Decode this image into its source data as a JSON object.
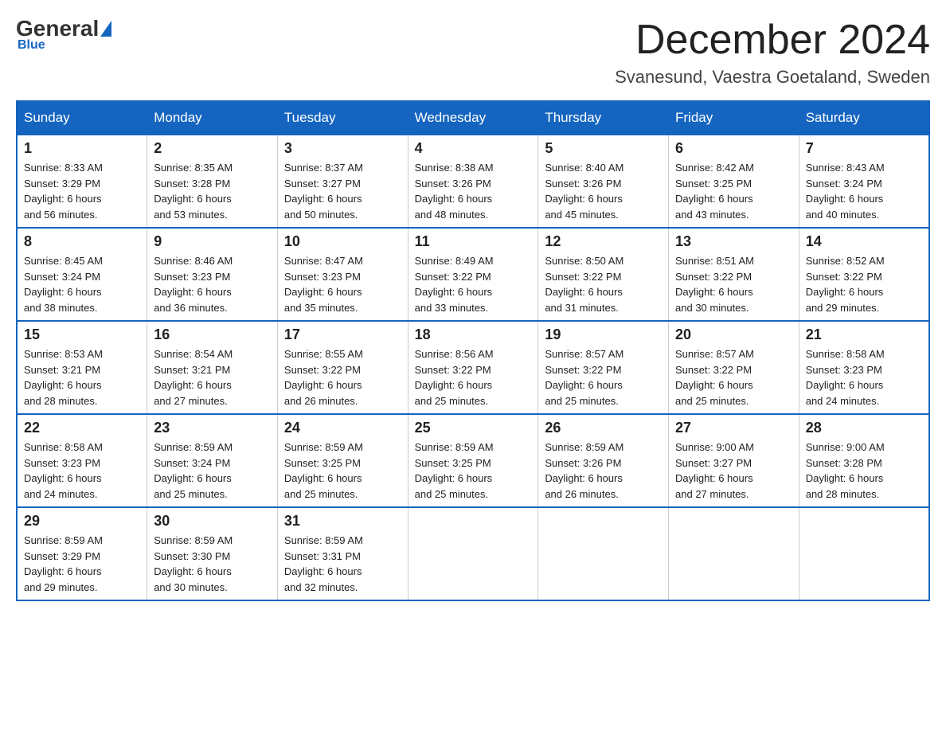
{
  "logo": {
    "general": "General",
    "blue_text": "Blue",
    "underline": "Blue"
  },
  "header": {
    "month": "December 2024",
    "location": "Svanesund, Vaestra Goetaland, Sweden"
  },
  "weekdays": [
    "Sunday",
    "Monday",
    "Tuesday",
    "Wednesday",
    "Thursday",
    "Friday",
    "Saturday"
  ],
  "weeks": [
    [
      {
        "day": "1",
        "sunrise": "8:33 AM",
        "sunset": "3:29 PM",
        "daylight": "6 hours and 56 minutes."
      },
      {
        "day": "2",
        "sunrise": "8:35 AM",
        "sunset": "3:28 PM",
        "daylight": "6 hours and 53 minutes."
      },
      {
        "day": "3",
        "sunrise": "8:37 AM",
        "sunset": "3:27 PM",
        "daylight": "6 hours and 50 minutes."
      },
      {
        "day": "4",
        "sunrise": "8:38 AM",
        "sunset": "3:26 PM",
        "daylight": "6 hours and 48 minutes."
      },
      {
        "day": "5",
        "sunrise": "8:40 AM",
        "sunset": "3:26 PM",
        "daylight": "6 hours and 45 minutes."
      },
      {
        "day": "6",
        "sunrise": "8:42 AM",
        "sunset": "3:25 PM",
        "daylight": "6 hours and 43 minutes."
      },
      {
        "day": "7",
        "sunrise": "8:43 AM",
        "sunset": "3:24 PM",
        "daylight": "6 hours and 40 minutes."
      }
    ],
    [
      {
        "day": "8",
        "sunrise": "8:45 AM",
        "sunset": "3:24 PM",
        "daylight": "6 hours and 38 minutes."
      },
      {
        "day": "9",
        "sunrise": "8:46 AM",
        "sunset": "3:23 PM",
        "daylight": "6 hours and 36 minutes."
      },
      {
        "day": "10",
        "sunrise": "8:47 AM",
        "sunset": "3:23 PM",
        "daylight": "6 hours and 35 minutes."
      },
      {
        "day": "11",
        "sunrise": "8:49 AM",
        "sunset": "3:22 PM",
        "daylight": "6 hours and 33 minutes."
      },
      {
        "day": "12",
        "sunrise": "8:50 AM",
        "sunset": "3:22 PM",
        "daylight": "6 hours and 31 minutes."
      },
      {
        "day": "13",
        "sunrise": "8:51 AM",
        "sunset": "3:22 PM",
        "daylight": "6 hours and 30 minutes."
      },
      {
        "day": "14",
        "sunrise": "8:52 AM",
        "sunset": "3:22 PM",
        "daylight": "6 hours and 29 minutes."
      }
    ],
    [
      {
        "day": "15",
        "sunrise": "8:53 AM",
        "sunset": "3:21 PM",
        "daylight": "6 hours and 28 minutes."
      },
      {
        "day": "16",
        "sunrise": "8:54 AM",
        "sunset": "3:21 PM",
        "daylight": "6 hours and 27 minutes."
      },
      {
        "day": "17",
        "sunrise": "8:55 AM",
        "sunset": "3:22 PM",
        "daylight": "6 hours and 26 minutes."
      },
      {
        "day": "18",
        "sunrise": "8:56 AM",
        "sunset": "3:22 PM",
        "daylight": "6 hours and 25 minutes."
      },
      {
        "day": "19",
        "sunrise": "8:57 AM",
        "sunset": "3:22 PM",
        "daylight": "6 hours and 25 minutes."
      },
      {
        "day": "20",
        "sunrise": "8:57 AM",
        "sunset": "3:22 PM",
        "daylight": "6 hours and 25 minutes."
      },
      {
        "day": "21",
        "sunrise": "8:58 AM",
        "sunset": "3:23 PM",
        "daylight": "6 hours and 24 minutes."
      }
    ],
    [
      {
        "day": "22",
        "sunrise": "8:58 AM",
        "sunset": "3:23 PM",
        "daylight": "6 hours and 24 minutes."
      },
      {
        "day": "23",
        "sunrise": "8:59 AM",
        "sunset": "3:24 PM",
        "daylight": "6 hours and 25 minutes."
      },
      {
        "day": "24",
        "sunrise": "8:59 AM",
        "sunset": "3:25 PM",
        "daylight": "6 hours and 25 minutes."
      },
      {
        "day": "25",
        "sunrise": "8:59 AM",
        "sunset": "3:25 PM",
        "daylight": "6 hours and 25 minutes."
      },
      {
        "day": "26",
        "sunrise": "8:59 AM",
        "sunset": "3:26 PM",
        "daylight": "6 hours and 26 minutes."
      },
      {
        "day": "27",
        "sunrise": "9:00 AM",
        "sunset": "3:27 PM",
        "daylight": "6 hours and 27 minutes."
      },
      {
        "day": "28",
        "sunrise": "9:00 AM",
        "sunset": "3:28 PM",
        "daylight": "6 hours and 28 minutes."
      }
    ],
    [
      {
        "day": "29",
        "sunrise": "8:59 AM",
        "sunset": "3:29 PM",
        "daylight": "6 hours and 29 minutes."
      },
      {
        "day": "30",
        "sunrise": "8:59 AM",
        "sunset": "3:30 PM",
        "daylight": "6 hours and 30 minutes."
      },
      {
        "day": "31",
        "sunrise": "8:59 AM",
        "sunset": "3:31 PM",
        "daylight": "6 hours and 32 minutes."
      },
      null,
      null,
      null,
      null
    ]
  ]
}
